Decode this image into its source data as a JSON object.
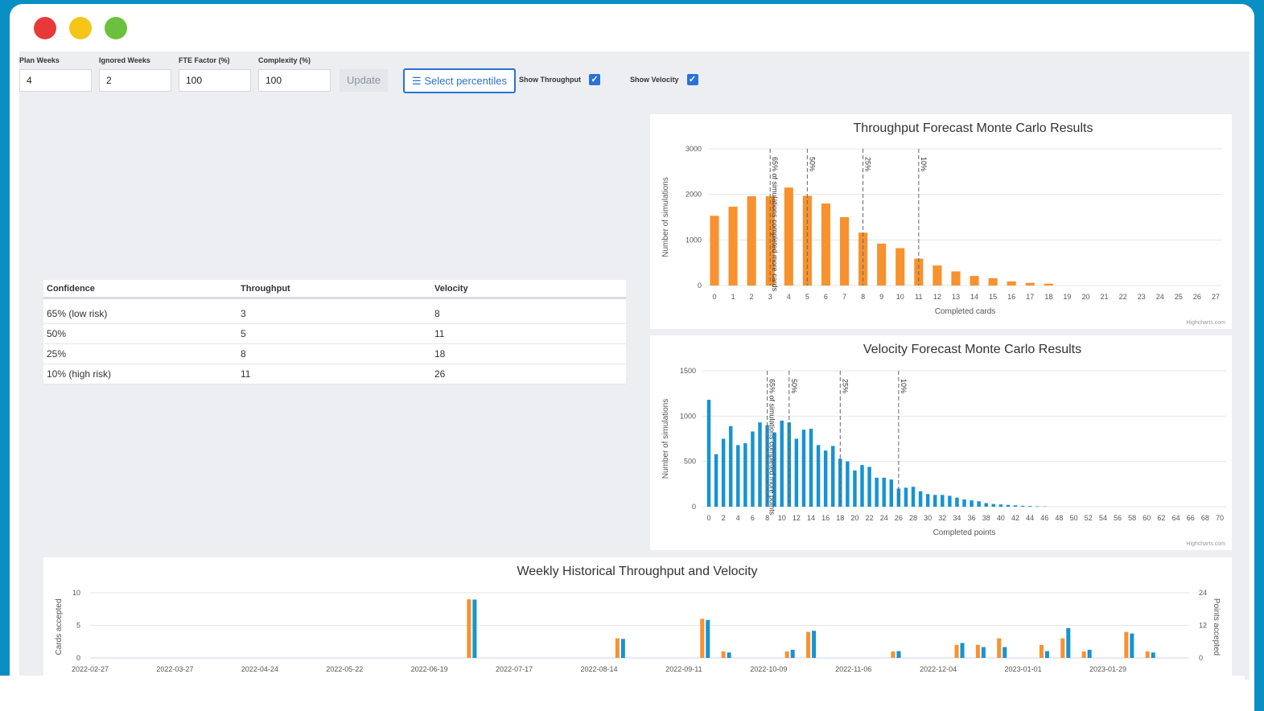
{
  "window": {
    "dots": [
      "close",
      "minimize",
      "maximize"
    ]
  },
  "controls": {
    "plan_weeks_label": "Plan Weeks",
    "plan_weeks_value": "4",
    "ignored_weeks_label": "Ignored Weeks",
    "ignored_weeks_value": "2",
    "fte_label": "FTE Factor (%)",
    "fte_value": "100",
    "complexity_label": "Complexity (%)",
    "complexity_value": "100",
    "update_label": "Update",
    "select_percentiles_label": "Select percentiles",
    "show_throughput_label": "Show Throughput",
    "show_velocity_label": "Show Velocity",
    "show_throughput_checked": true,
    "show_velocity_checked": true
  },
  "table": {
    "headers": [
      "Confidence",
      "Throughput",
      "Velocity"
    ],
    "rows": [
      [
        "65% (low risk)",
        "3",
        "8"
      ],
      [
        "50%",
        "5",
        "11"
      ],
      [
        "25%",
        "8",
        "18"
      ],
      [
        "10% (high risk)",
        "11",
        "26"
      ]
    ]
  },
  "colors": {
    "orange": "#f7922f",
    "blue": "#1793d1",
    "accent": "#2a72d4"
  },
  "chart_data": [
    {
      "type": "bar",
      "title": "Throughput Forecast Monte Carlo Results",
      "xlabel": "Completed cards",
      "ylabel": "Number of simulations",
      "credit": "Highcharts.com",
      "ylim": [
        0,
        3000
      ],
      "yticks": [
        0,
        1000,
        2000,
        3000
      ],
      "x": [
        0,
        1,
        2,
        3,
        4,
        5,
        6,
        7,
        8,
        9,
        10,
        11,
        12,
        13,
        14,
        15,
        16,
        17,
        18,
        19,
        20,
        21,
        22,
        23,
        24,
        25,
        26,
        27
      ],
      "values": [
        1530,
        1730,
        1960,
        1960,
        2150,
        1970,
        1800,
        1500,
        1160,
        920,
        820,
        590,
        440,
        310,
        210,
        160,
        90,
        60,
        40,
        0,
        0,
        0,
        0,
        0,
        0,
        0,
        0,
        0
      ],
      "plotlines": [
        {
          "x": 3,
          "label": "65% of simulations completed more cards"
        },
        {
          "x": 5,
          "label": "50%"
        },
        {
          "x": 8,
          "label": "25%"
        },
        {
          "x": 11,
          "label": "10%"
        }
      ],
      "color": "#f7922f"
    },
    {
      "type": "bar",
      "title": "Velocity Forecast Monte Carlo Results",
      "xlabel": "Completed points",
      "ylabel": "Number of simulations",
      "credit": "Highcharts.com",
      "ylim": [
        0,
        1500
      ],
      "yticks": [
        0,
        500,
        1000,
        1500
      ],
      "xticks": [
        0,
        2,
        4,
        6,
        8,
        10,
        12,
        14,
        16,
        18,
        20,
        22,
        24,
        26,
        28,
        30,
        32,
        34,
        36,
        38,
        40,
        42,
        44,
        46,
        48,
        50,
        52,
        54,
        56,
        58,
        60,
        62,
        64,
        66,
        68,
        70
      ],
      "x": [
        0,
        1,
        2,
        3,
        4,
        5,
        6,
        7,
        8,
        9,
        10,
        11,
        12,
        13,
        14,
        15,
        16,
        17,
        18,
        19,
        20,
        21,
        22,
        23,
        24,
        25,
        26,
        27,
        28,
        29,
        30,
        31,
        32,
        33,
        34,
        35,
        36,
        37,
        38,
        39,
        40,
        41,
        42,
        43,
        44,
        45,
        46
      ],
      "values": [
        1180,
        580,
        750,
        890,
        680,
        700,
        830,
        930,
        900,
        820,
        950,
        930,
        750,
        850,
        860,
        680,
        620,
        670,
        530,
        500,
        400,
        460,
        440,
        320,
        320,
        300,
        200,
        210,
        220,
        170,
        140,
        130,
        130,
        120,
        100,
        80,
        70,
        60,
        40,
        30,
        25,
        20,
        15,
        10,
        8,
        5,
        3
      ],
      "plotlines": [
        {
          "x": 8,
          "label": "65% of simulations completed more points"
        },
        {
          "x": 11,
          "label": "50%"
        },
        {
          "x": 18,
          "label": "25%"
        },
        {
          "x": 26,
          "label": "10%"
        }
      ],
      "color": "#1793d1"
    },
    {
      "type": "bar",
      "title": "Weekly Historical Throughput and Velocity",
      "ylabel": "Cards accepted",
      "y2label": "Points accepted",
      "ylim": [
        0,
        10
      ],
      "y2lim": [
        0,
        24
      ],
      "yticks": [
        0,
        5,
        10
      ],
      "y2ticks": [
        0,
        12,
        24
      ],
      "xtick_labels": [
        "2022-02-27",
        "2022-03-27",
        "2022-04-24",
        "2022-05-22",
        "2022-06-19",
        "2022-07-17",
        "2022-08-14",
        "2022-09-11",
        "2022-10-09",
        "2022-11-06",
        "2022-12-04",
        "2023-01-01",
        "2023-01-29"
      ],
      "series": [
        {
          "name": "Cards accepted",
          "color": "#f7922f",
          "points": [
            [
              "2022-07-03",
              9
            ],
            [
              "2022-08-21",
              3
            ],
            [
              "2022-09-18",
              6
            ],
            [
              "2022-09-25",
              1
            ],
            [
              "2022-10-16",
              1
            ],
            [
              "2022-10-23",
              4
            ],
            [
              "2022-11-20",
              1
            ],
            [
              "2022-12-11",
              2
            ],
            [
              "2022-12-18",
              2
            ],
            [
              "2022-12-25",
              3
            ],
            [
              "2023-01-08",
              2
            ],
            [
              "2023-01-15",
              3
            ],
            [
              "2023-01-22",
              1
            ],
            [
              "2023-02-05",
              4
            ],
            [
              "2023-02-12",
              1
            ]
          ]
        },
        {
          "name": "Points accepted",
          "color": "#1793d1",
          "points": [
            [
              "2022-07-03",
              21.5
            ],
            [
              "2022-08-21",
              7
            ],
            [
              "2022-09-18",
              14
            ],
            [
              "2022-09-25",
              2
            ],
            [
              "2022-10-16",
              3
            ],
            [
              "2022-10-23",
              10
            ],
            [
              "2022-11-20",
              2.5
            ],
            [
              "2022-12-11",
              5.5
            ],
            [
              "2022-12-18",
              4
            ],
            [
              "2022-12-25",
              4
            ],
            [
              "2023-01-08",
              2.5
            ],
            [
              "2023-01-15",
              11
            ],
            [
              "2023-01-22",
              3
            ],
            [
              "2023-02-05",
              9
            ],
            [
              "2023-02-12",
              2
            ]
          ]
        }
      ]
    }
  ]
}
